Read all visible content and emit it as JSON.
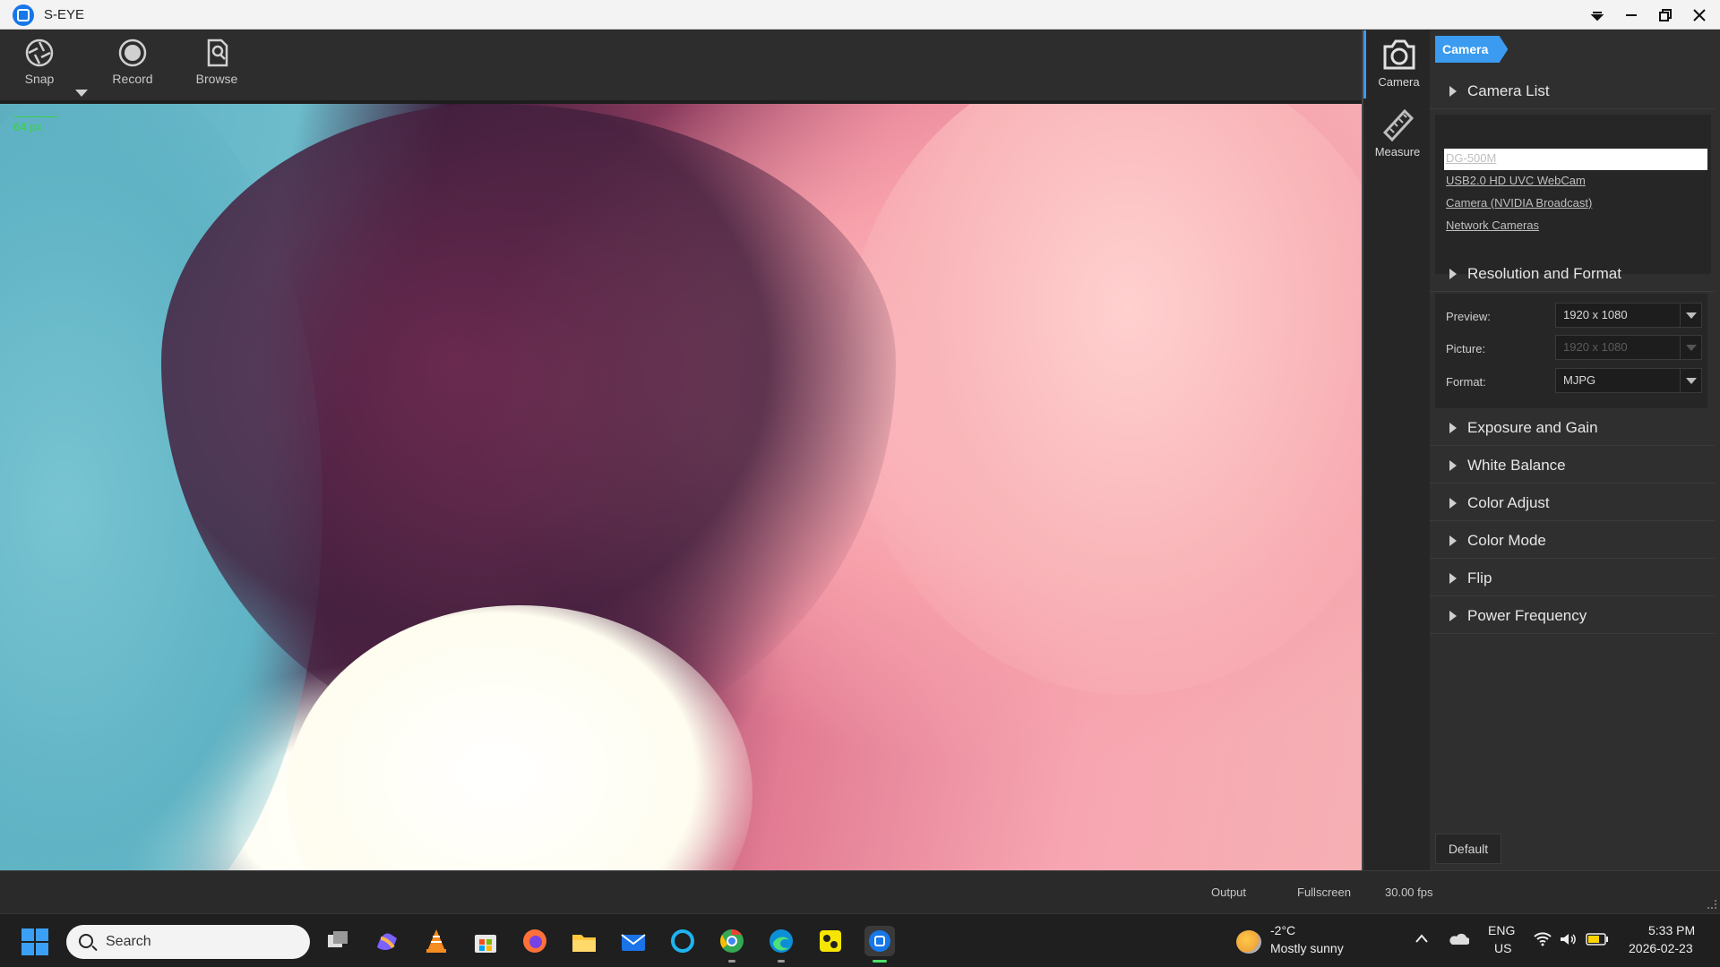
{
  "window": {
    "title": "S-EYE",
    "controls": [
      "collapse-icon",
      "minimize-icon",
      "restore-icon",
      "close-icon"
    ]
  },
  "toolbar": {
    "snap_label": "Snap",
    "record_label": "Record",
    "browse_label": "Browse"
  },
  "preview": {
    "scale_label": "64 px"
  },
  "rightnav": {
    "camera_label": "Camera",
    "measure_label": "Measure"
  },
  "panel": {
    "tab_label": "Camera",
    "camera_list_title": "Camera List",
    "cameras": [
      "DG-500M",
      "USB2.0 HD UVC WebCam",
      "Camera (NVIDIA Broadcast)",
      "Network Cameras"
    ],
    "selected_camera_index": 0,
    "resolution_title": "Resolution and Format",
    "preview_label": "Preview:",
    "preview_value": "1920 x 1080",
    "picture_label": "Picture:",
    "picture_value": "1920 x 1080",
    "format_label": "Format:",
    "format_value": "MJPG",
    "sections": [
      "Exposure and Gain",
      "White Balance",
      "Color Adjust",
      "Color Mode",
      "Flip",
      "Power Frequency"
    ],
    "default_label": "Default"
  },
  "statusbar": {
    "output_label": "Output",
    "fullscreen_label": "Fullscreen",
    "fps": "30.00 fps"
  },
  "taskbar": {
    "search_placeholder": "Search",
    "apps": [
      "task-view-icon",
      "copilot-icon",
      "vlc-icon",
      "store-icon",
      "firefox-icon",
      "file-explorer-icon",
      "mail-icon",
      "cortana-icon",
      "chrome-icon",
      "edge-icon",
      "yellow-app-icon",
      "s-eye-icon"
    ],
    "weather_temp": "-2°C",
    "weather_desc": "Mostly sunny",
    "lang": "ENG",
    "region": "US",
    "time": "5:33 PM",
    "date": "2026-02-23"
  },
  "colors": {
    "accent": "#3a9bf0",
    "scale_green": "#3bd04a",
    "active_app_indicator": "#4ddf6a"
  }
}
